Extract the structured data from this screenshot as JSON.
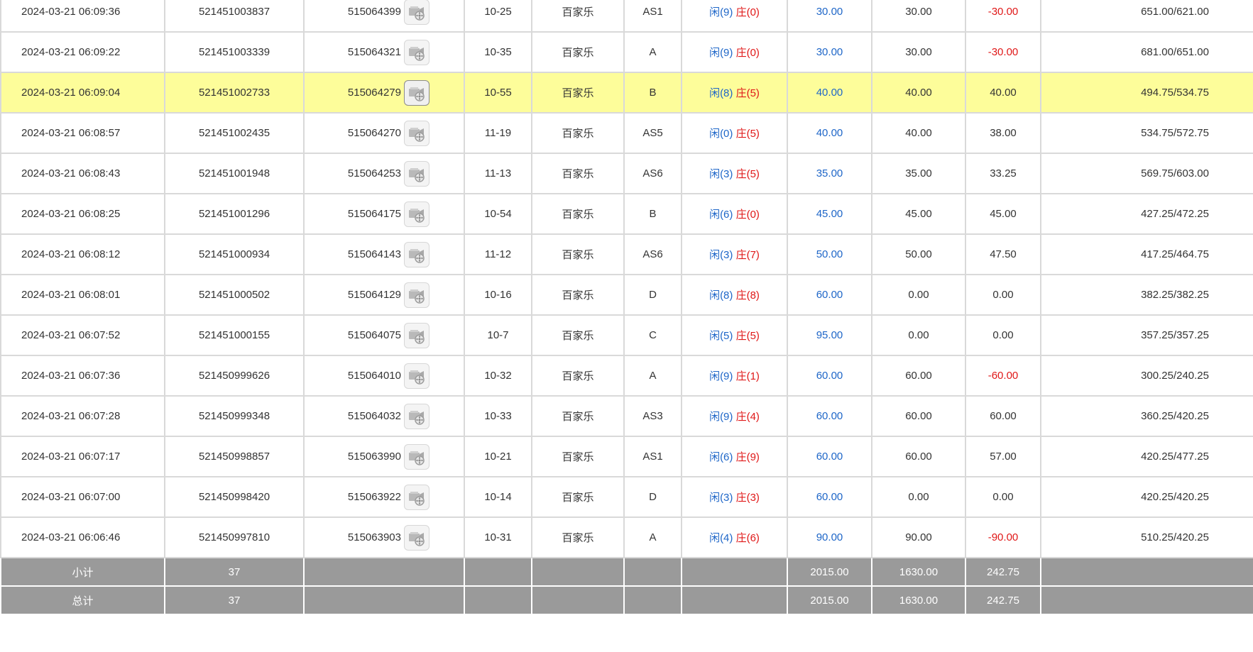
{
  "rows": [
    {
      "time": "2024-03-21 06:09:36",
      "order": "521451003837",
      "round": "515064399",
      "table": "10-25",
      "game": "百家乐",
      "seat": "AS1",
      "res_p": "闲(9)",
      "res_b": "庄(0)",
      "bet": "30.00",
      "valid": "30.00",
      "win": "-30.00",
      "win_neg": true,
      "balance": "651.00/621.00"
    },
    {
      "time": "2024-03-21 06:09:22",
      "order": "521451003339",
      "round": "515064321",
      "table": "10-35",
      "game": "百家乐",
      "seat": "A",
      "res_p": "闲(9)",
      "res_b": "庄(0)",
      "bet": "30.00",
      "valid": "30.00",
      "win": "-30.00",
      "win_neg": true,
      "balance": "681.00/651.00"
    },
    {
      "time": "2024-03-21 06:09:04",
      "order": "521451002733",
      "round": "515064279",
      "table": "10-55",
      "game": "百家乐",
      "seat": "B",
      "res_p": "闲(8)",
      "res_b": "庄(5)",
      "bet": "40.00",
      "valid": "40.00",
      "win": "40.00",
      "win_neg": false,
      "balance": "494.75/534.75",
      "highlight": true
    },
    {
      "time": "2024-03-21 06:08:57",
      "order": "521451002435",
      "round": "515064270",
      "table": "11-19",
      "game": "百家乐",
      "seat": "AS5",
      "res_p": "闲(0)",
      "res_b": "庄(5)",
      "bet": "40.00",
      "valid": "40.00",
      "win": "38.00",
      "win_neg": false,
      "balance": "534.75/572.75"
    },
    {
      "time": "2024-03-21 06:08:43",
      "order": "521451001948",
      "round": "515064253",
      "table": "11-13",
      "game": "百家乐",
      "seat": "AS6",
      "res_p": "闲(3)",
      "res_b": "庄(5)",
      "bet": "35.00",
      "valid": "35.00",
      "win": "33.25",
      "win_neg": false,
      "balance": "569.75/603.00"
    },
    {
      "time": "2024-03-21 06:08:25",
      "order": "521451001296",
      "round": "515064175",
      "table": "10-54",
      "game": "百家乐",
      "seat": "B",
      "res_p": "闲(6)",
      "res_b": "庄(0)",
      "bet": "45.00",
      "valid": "45.00",
      "win": "45.00",
      "win_neg": false,
      "balance": "427.25/472.25"
    },
    {
      "time": "2024-03-21 06:08:12",
      "order": "521451000934",
      "round": "515064143",
      "table": "11-12",
      "game": "百家乐",
      "seat": "AS6",
      "res_p": "闲(3)",
      "res_b": "庄(7)",
      "bet": "50.00",
      "valid": "50.00",
      "win": "47.50",
      "win_neg": false,
      "balance": "417.25/464.75"
    },
    {
      "time": "2024-03-21 06:08:01",
      "order": "521451000502",
      "round": "515064129",
      "table": "10-16",
      "game": "百家乐",
      "seat": "D",
      "res_p": "闲(8)",
      "res_b": "庄(8)",
      "bet": "60.00",
      "valid": "0.00",
      "win": "0.00",
      "win_neg": false,
      "balance": "382.25/382.25"
    },
    {
      "time": "2024-03-21 06:07:52",
      "order": "521451000155",
      "round": "515064075",
      "table": "10-7",
      "game": "百家乐",
      "seat": "C",
      "res_p": "闲(5)",
      "res_b": "庄(5)",
      "bet": "95.00",
      "valid": "0.00",
      "win": "0.00",
      "win_neg": false,
      "balance": "357.25/357.25"
    },
    {
      "time": "2024-03-21 06:07:36",
      "order": "521450999626",
      "round": "515064010",
      "table": "10-32",
      "game": "百家乐",
      "seat": "A",
      "res_p": "闲(9)",
      "res_b": "庄(1)",
      "bet": "60.00",
      "valid": "60.00",
      "win": "-60.00",
      "win_neg": true,
      "balance": "300.25/240.25"
    },
    {
      "time": "2024-03-21 06:07:28",
      "order": "521450999348",
      "round": "515064032",
      "table": "10-33",
      "game": "百家乐",
      "seat": "AS3",
      "res_p": "闲(9)",
      "res_b": "庄(4)",
      "bet": "60.00",
      "valid": "60.00",
      "win": "60.00",
      "win_neg": false,
      "balance": "360.25/420.25"
    },
    {
      "time": "2024-03-21 06:07:17",
      "order": "521450998857",
      "round": "515063990",
      "table": "10-21",
      "game": "百家乐",
      "seat": "AS1",
      "res_p": "闲(6)",
      "res_b": "庄(9)",
      "bet": "60.00",
      "valid": "60.00",
      "win": "57.00",
      "win_neg": false,
      "balance": "420.25/477.25"
    },
    {
      "time": "2024-03-21 06:07:00",
      "order": "521450998420",
      "round": "515063922",
      "table": "10-14",
      "game": "百家乐",
      "seat": "D",
      "res_p": "闲(3)",
      "res_b": "庄(3)",
      "bet": "60.00",
      "valid": "0.00",
      "win": "0.00",
      "win_neg": false,
      "balance": "420.25/420.25"
    },
    {
      "time": "2024-03-21 06:06:46",
      "order": "521450997810",
      "round": "515063903",
      "table": "10-31",
      "game": "百家乐",
      "seat": "A",
      "res_p": "闲(4)",
      "res_b": "庄(6)",
      "bet": "90.00",
      "valid": "90.00",
      "win": "-90.00",
      "win_neg": true,
      "balance": "510.25/420.25"
    }
  ],
  "subtotal": {
    "label": "小计",
    "count": "37",
    "bet": "2015.00",
    "valid": "1630.00",
    "win": "242.75"
  },
  "total": {
    "label": "总计",
    "count": "37",
    "bet": "2015.00",
    "valid": "1630.00",
    "win": "242.75"
  },
  "icons": {
    "replay": "film-reel-video-icon"
  },
  "colors": {
    "bet_blue": "#1e66c8",
    "loss_red": "#e01818",
    "highlight": "#fdfd9a",
    "summary_bg": "#9a9a9a"
  }
}
